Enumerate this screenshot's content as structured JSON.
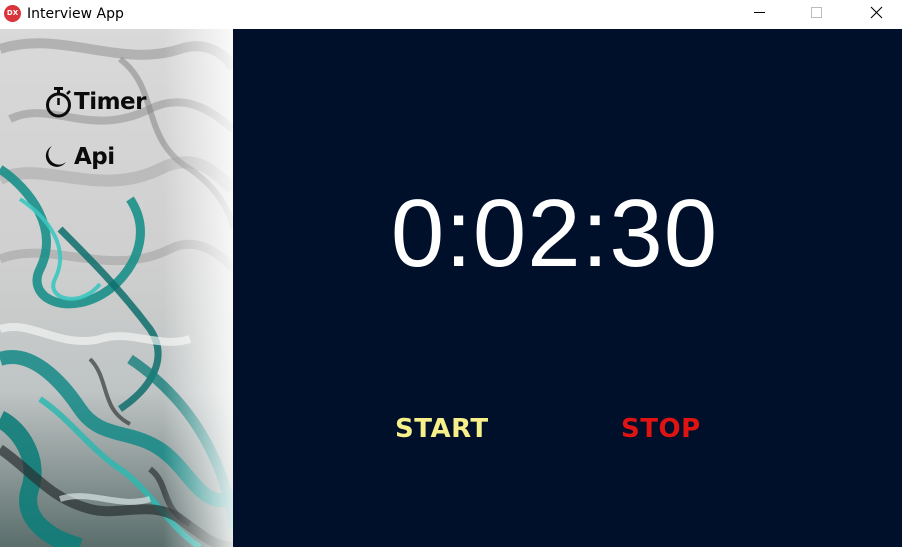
{
  "window": {
    "title": "Interview App",
    "icon_label": "DX",
    "controls": [
      "minimize",
      "maximize",
      "close"
    ]
  },
  "sidebar": {
    "items": [
      {
        "label": "Timer",
        "icon": "stopwatch-icon"
      },
      {
        "label": "Api",
        "icon": "moon-icon"
      }
    ]
  },
  "main": {
    "timer_value": "0:02:30",
    "start_label": "START",
    "stop_label": "STOP"
  },
  "colors": {
    "main_background": "#01102a",
    "timer_text": "#ffffff",
    "start_button": "#f6ef8a",
    "stop_button": "#e01313",
    "app_icon": "#d8343a"
  }
}
